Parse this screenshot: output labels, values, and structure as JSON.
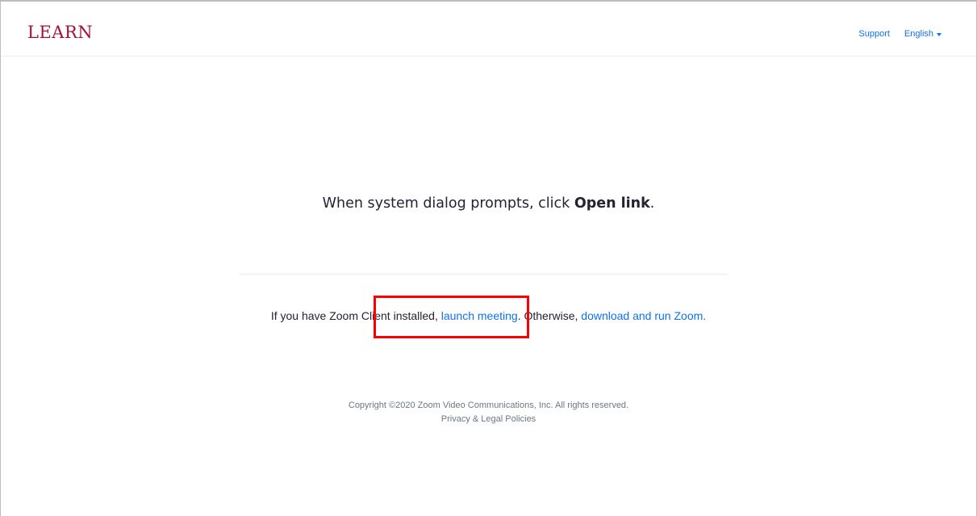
{
  "header": {
    "logo_text": "LEARN",
    "support_label": "Support",
    "language_label": "English"
  },
  "main": {
    "prompt_text": "When system dialog prompts, click ",
    "prompt_bold": "Open link",
    "prompt_end": ".",
    "launch_prefix": "If you have Zoom Client installed, ",
    "launch_link": "launch meeting",
    "launch_middle": ". Otherwise, ",
    "download_link": "download and run Zoom."
  },
  "footer": {
    "copyright": "Copyright ©2020 Zoom Video Communications, Inc. All rights reserved.",
    "policies_link": "Privacy & Legal Policies"
  },
  "colors": {
    "brand": "#a3123a",
    "link": "#0e72ed",
    "highlight": "#ff0000"
  }
}
